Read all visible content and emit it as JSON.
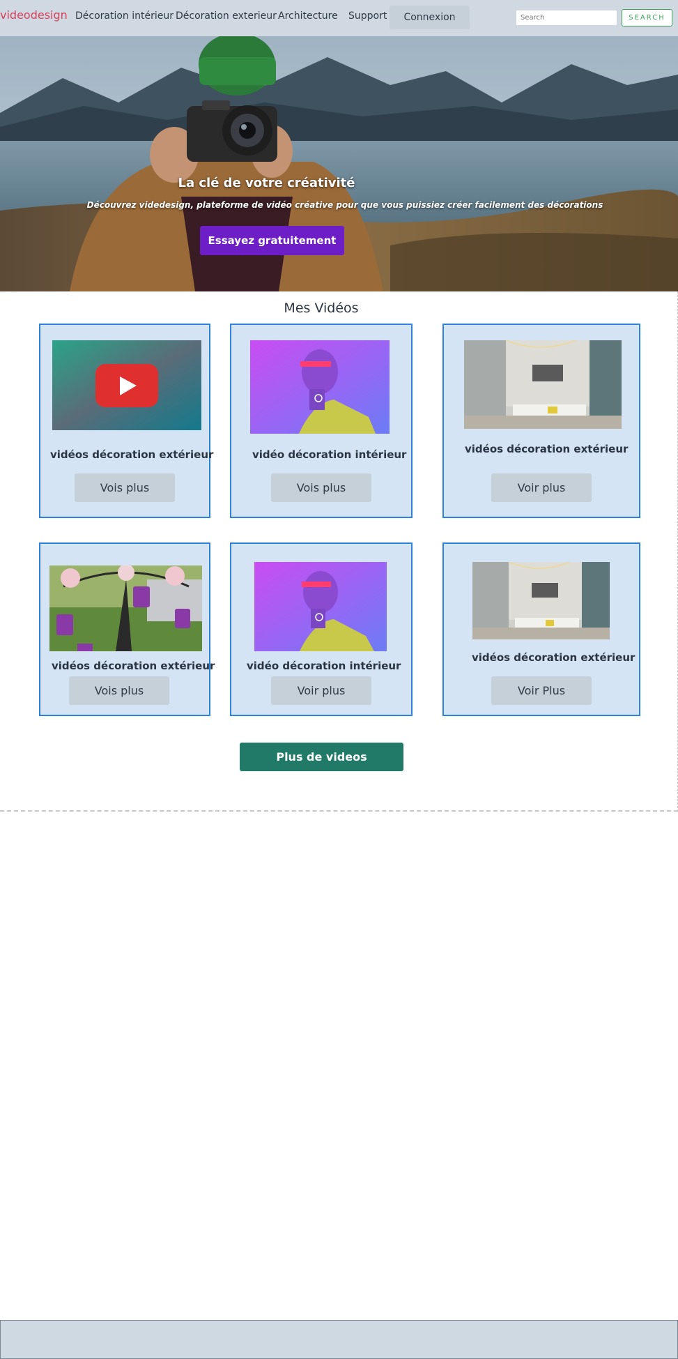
{
  "nav": {
    "brand": "videodesign",
    "links": [
      "Décoration intérieur",
      "Décoration exterieur",
      "Architecture",
      "Support"
    ],
    "connexion": "Connexion",
    "search_placeholder": "Search",
    "search_button": "SEARCH"
  },
  "hero": {
    "title": "La clé de votre créativité",
    "subtitle": "Découvrez videdesign, plateforme de  vidéo créative pour que vous puissiez créer facilement des décorations",
    "cta": "Essayez gratuitement"
  },
  "section": {
    "title": "Mes Vidéos"
  },
  "cards": [
    {
      "title": "vidéos décoration extérieur",
      "button": "Vois plus",
      "image": "youtube-thumbnail"
    },
    {
      "title": "vidéo décoration intérieur",
      "button": "Vois plus",
      "image": "neon-portrait"
    },
    {
      "title": "vidéos décoration extérieur",
      "button": "Voir plus",
      "image": "living-room"
    },
    {
      "title": "vidéos décoration extérieur",
      "button": "Vois plus",
      "image": "hanging-lanterns"
    },
    {
      "title": "vidéo décoration intérieur",
      "button": "Voir plus",
      "image": "neon-portrait"
    },
    {
      "title": "vidéos décoration extérieur",
      "button": "Voir Plus",
      "image": "living-room"
    }
  ],
  "more_button": "Plus de videos",
  "colors": {
    "navbar": "#d0d9e1",
    "brand": "#d8415a",
    "cta": "#6e1ec6",
    "card_bg": "#d4e4f4",
    "card_border": "#2f83d6",
    "more_button": "#207a67",
    "search_accent": "#3ea35a"
  }
}
